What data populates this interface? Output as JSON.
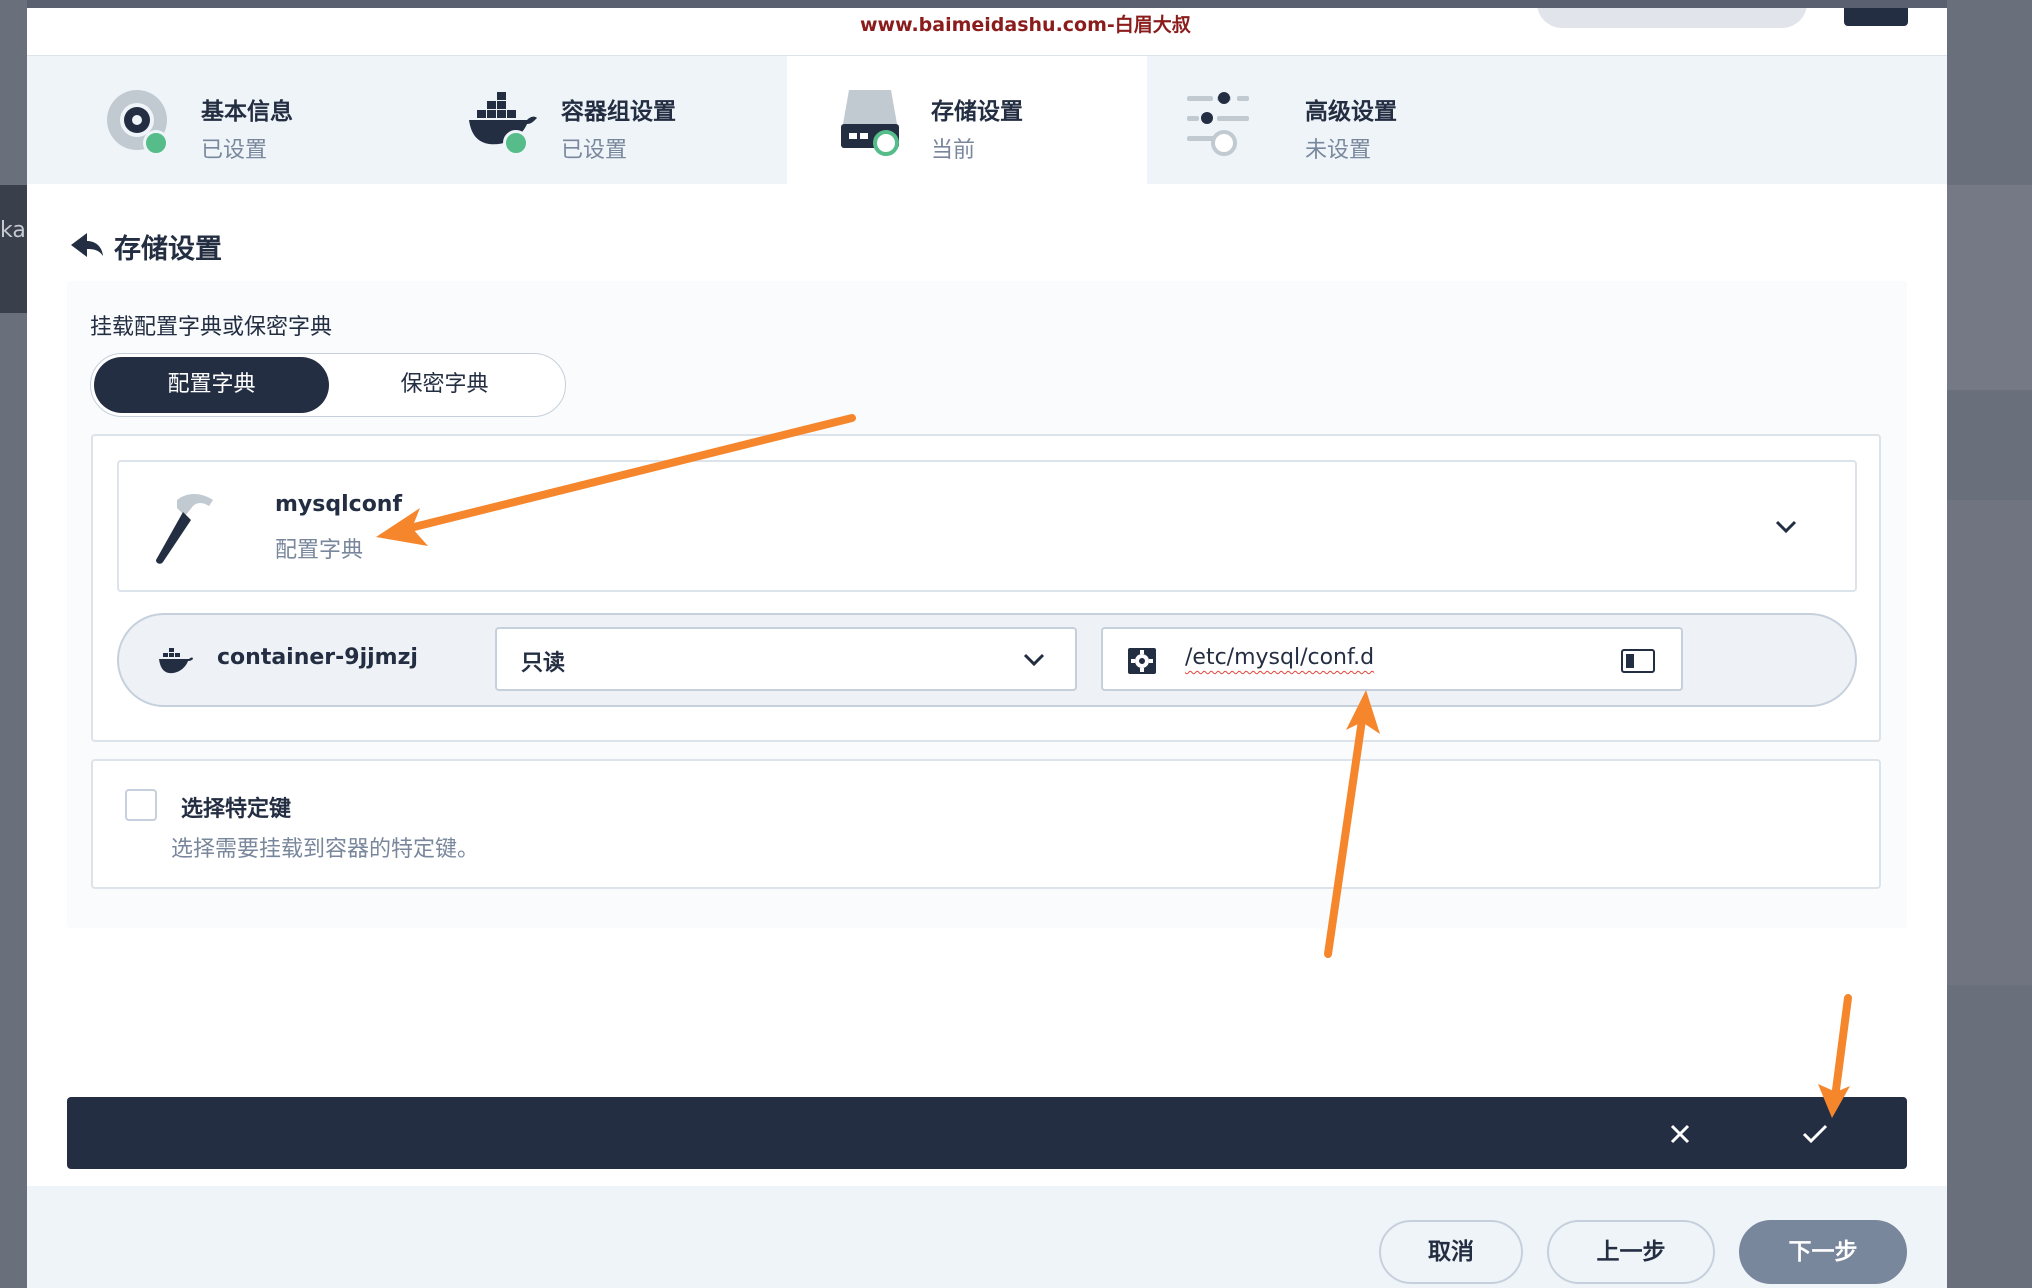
{
  "watermark": "www.baimeidashu.com-白眉大叔",
  "background": {
    "left_text": "ka"
  },
  "steps": [
    {
      "title": "基本信息",
      "status": "已设置",
      "icon": "disc-icon"
    },
    {
      "title": "容器组设置",
      "status": "已设置",
      "icon": "docker-whale-icon"
    },
    {
      "title": "存储设置",
      "status": "当前",
      "icon": "hard-drive-icon"
    },
    {
      "title": "高级设置",
      "status": "未设置",
      "icon": "sliders-icon"
    }
  ],
  "section": {
    "title": "存储设置",
    "back_icon": "back-arrow-icon"
  },
  "mount": {
    "label": "挂载配置字典或保密字典",
    "tabs": [
      "配置字典",
      "保密字典"
    ],
    "selected_tab": "配置字典"
  },
  "config_select": {
    "name": "mysqlconf",
    "type": "配置字典",
    "icon": "hammer-icon"
  },
  "container_mount": {
    "container": "container-9jjmzj",
    "mode": "只读",
    "path": "/etc/mysql/conf.d"
  },
  "specific_keys": {
    "title": "选择特定键",
    "description": "选择需要挂载到容器的特定键。",
    "checked": false
  },
  "footer": {
    "cancel": "取消",
    "prev": "上一步",
    "next": "下一步"
  },
  "colors": {
    "primary_dark": "#242e42",
    "success_green": "#55bc8a",
    "annotation_orange": "#f5862c",
    "muted_text": "#79879c"
  }
}
